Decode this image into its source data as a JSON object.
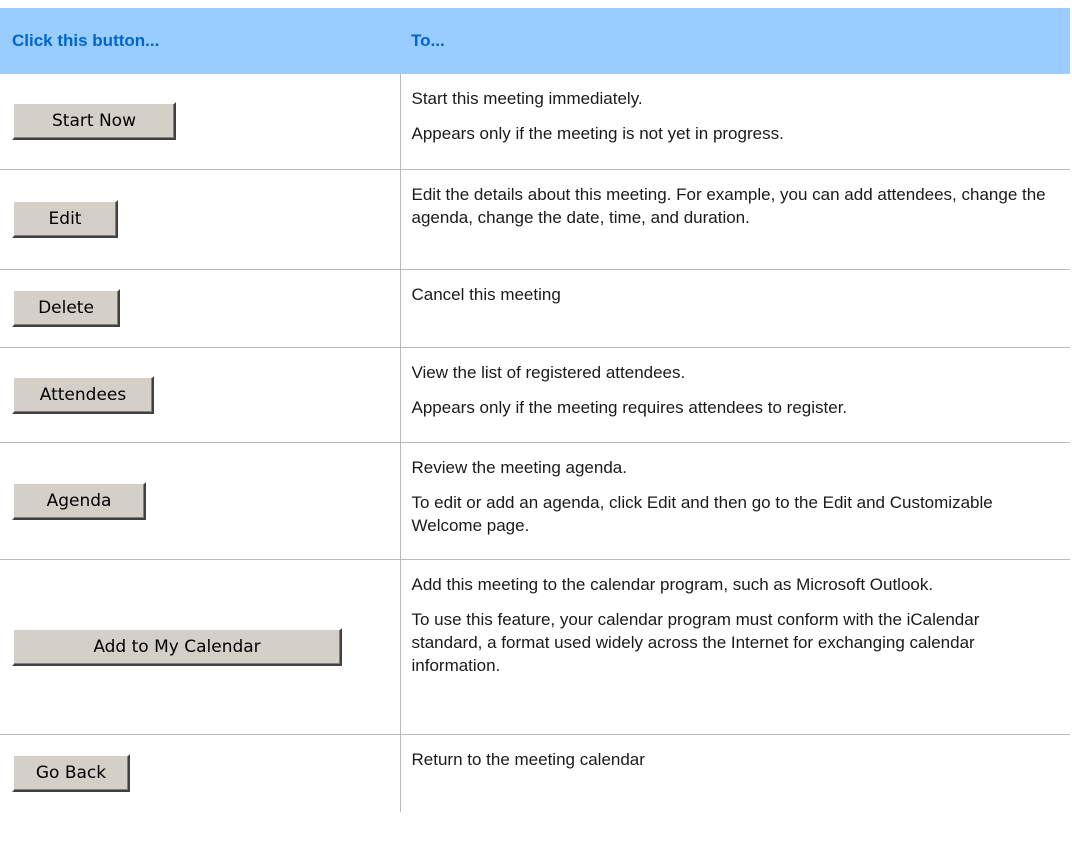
{
  "table": {
    "headers": [
      "Click this button...",
      "To..."
    ],
    "rows": [
      {
        "button": "Start Now",
        "descriptions": [
          "Start this meeting immediately.",
          "Appears only if the meeting is not yet in progress."
        ]
      },
      {
        "button": "Edit",
        "descriptions": [
          "Edit the details about this meeting. For example, you can add attendees, change the agenda, change the date, time, and duration."
        ]
      },
      {
        "button": "Delete",
        "descriptions": [
          "Cancel this meeting"
        ]
      },
      {
        "button": "Attendees",
        "descriptions": [
          "View the list of registered attendees.",
          "Appears only if the meeting requires attendees to register."
        ]
      },
      {
        "button": "Agenda",
        "descriptions": [
          "Review the meeting agenda.",
          "To edit or add an agenda, click Edit and then go to the Edit and Customizable Welcome page."
        ]
      },
      {
        "button": "Add to My Calendar",
        "descriptions": [
          "Add this meeting to the calendar program, such as Microsoft Outlook.",
          "To use this feature, your calendar program must conform with the iCalendar standard, a format used widely across the Internet for exchanging calendar information."
        ]
      },
      {
        "button": "Go Back",
        "descriptions": [
          "Return to the meeting calendar"
        ]
      }
    ]
  },
  "colors": {
    "header_bg": "#99ccff",
    "header_text": "#0066cc",
    "button_face": "#d4d0c8",
    "rule": "#b9b9b9"
  }
}
